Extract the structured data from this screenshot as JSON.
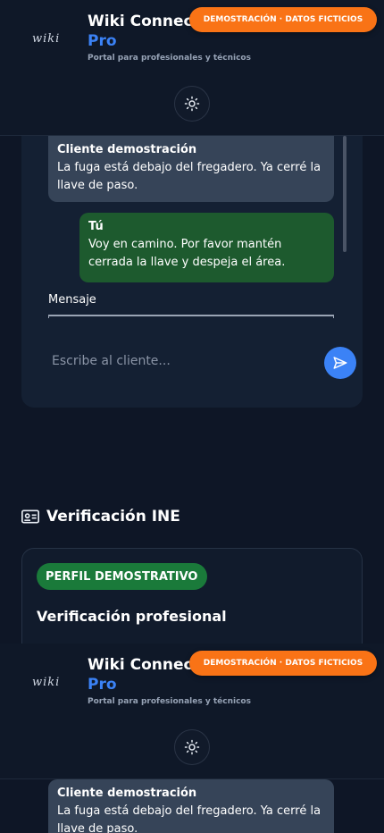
{
  "header": {
    "logo_text": "wiki",
    "title": "Wiki Connect",
    "subtitle": "Pro",
    "tagline": "Portal para profesionales y técnicos",
    "demo_badge": "DEMOSTRACIÓN · DATOS FICTICIOS",
    "theme_icon": "sun-icon"
  },
  "chat": {
    "messages": [
      {
        "sender": "Cliente demostración",
        "text": "La fuga está debajo del fregadero. Ya cerré la llave de paso."
      },
      {
        "sender": "Tú",
        "text": "Voy en camino. Por favor mantén cerrada la llave y despeja el área."
      }
    ],
    "message_label": "Mensaje",
    "composer_placeholder": "Escribe al cliente...",
    "send_icon": "send-icon"
  },
  "verification": {
    "section_title": "Verificación INE",
    "section_icon": "id-card-icon",
    "profile_badge": "PERFIL DEMOSTRATIVO",
    "heading": "Verificación profesional"
  },
  "colors": {
    "background": "#0e1626",
    "accent": "#3b82f6",
    "demo_badge": "#f97316",
    "own_bubble": "#1d5a2e",
    "client_bubble": "#364458",
    "profile_badge": "#1a7a3a"
  }
}
